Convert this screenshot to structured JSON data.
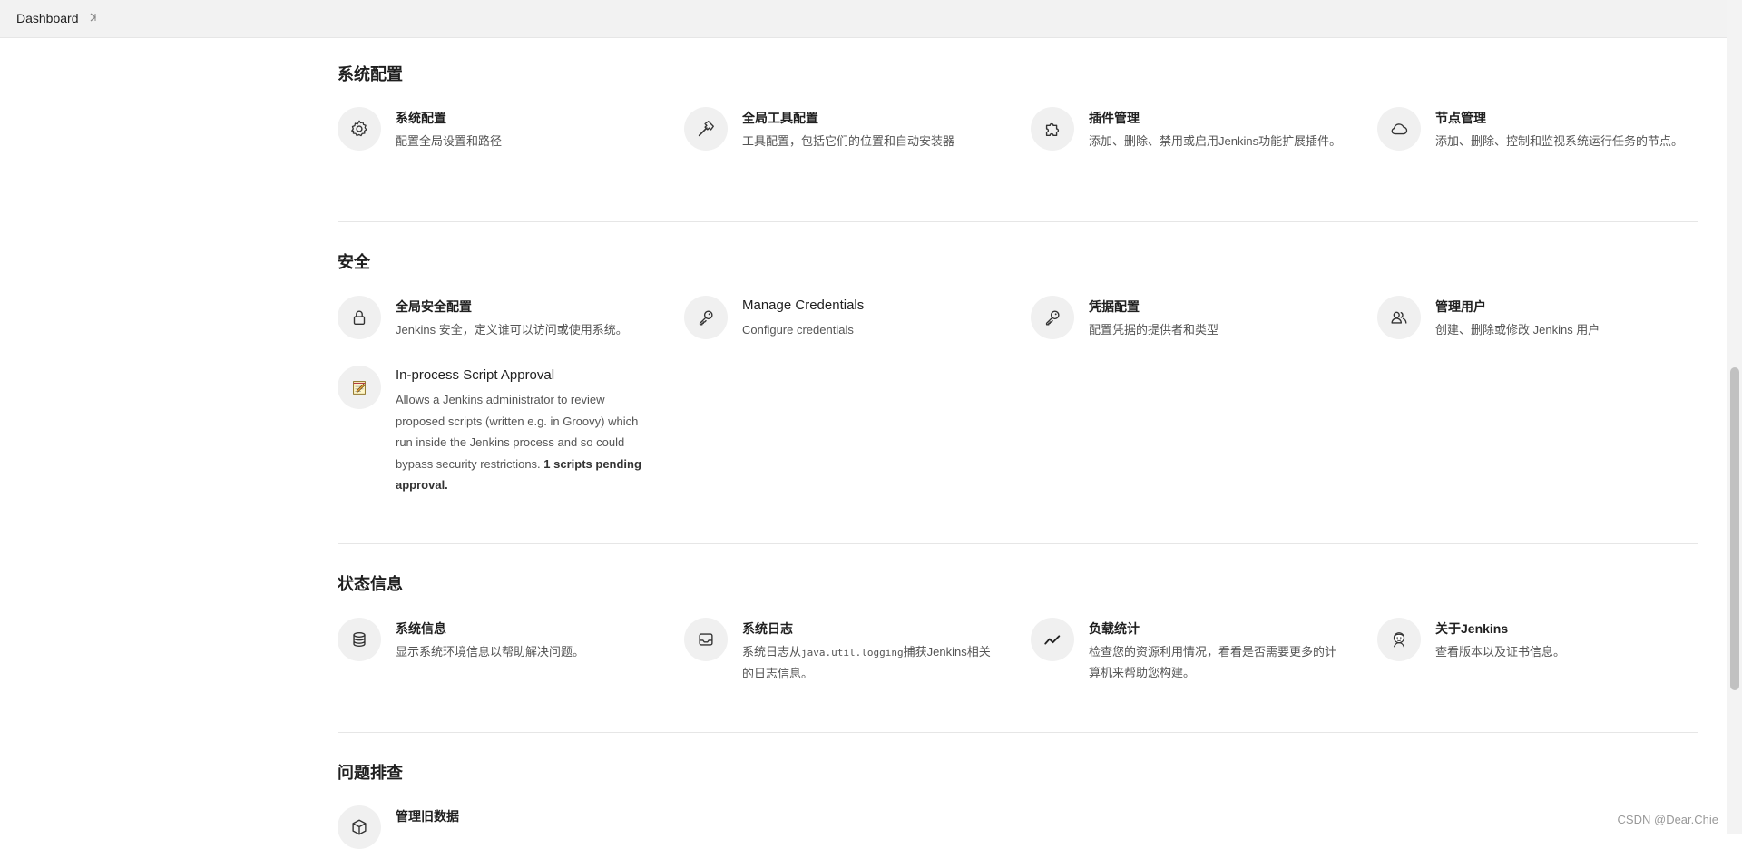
{
  "breadcrumb": {
    "label": "Dashboard"
  },
  "sections": {
    "system": {
      "title": "系统配置",
      "items": [
        {
          "title": "系统配置",
          "desc": "配置全局设置和路径",
          "icon": "gear-icon"
        },
        {
          "title": "全局工具配置",
          "desc": "工具配置，包括它们的位置和自动安装器",
          "icon": "hammer-icon"
        },
        {
          "title": "插件管理",
          "desc": "添加、删除、禁用或启用Jenkins功能扩展插件。",
          "icon": "puzzle-icon"
        },
        {
          "title": "节点管理",
          "desc": "添加、删除、控制和监视系统运行任务的节点。",
          "icon": "cloud-icon"
        }
      ]
    },
    "security": {
      "title": "安全",
      "items": [
        {
          "title": "全局安全配置",
          "desc": "Jenkins 安全，定义谁可以访问或使用系统。",
          "icon": "lock-icon"
        },
        {
          "title": "Manage Credentials",
          "desc": "Configure credentials",
          "icon": "key-icon"
        },
        {
          "title": "凭据配置",
          "desc": "配置凭据的提供者和类型",
          "icon": "key-icon"
        },
        {
          "title": "管理用户",
          "desc": "创建、删除或修改 Jenkins 用户",
          "icon": "users-icon"
        },
        {
          "title": "In-process Script Approval",
          "desc": "Allows a Jenkins administrator to review proposed scripts (written e.g. in Groovy) which run inside the Jenkins process and so could bypass security restrictions.",
          "desc_bold": "1 scripts pending approval.",
          "icon": "notepad-icon"
        }
      ]
    },
    "status": {
      "title": "状态信息",
      "items": [
        {
          "title": "系统信息",
          "desc": "显示系统环境信息以帮助解决问题。",
          "icon": "database-icon"
        },
        {
          "title": "系统日志",
          "desc_pre": "系统日志从",
          "desc_code": "java.util.logging",
          "desc_post": "捕获Jenkins相关的日志信息。",
          "icon": "inbox-icon"
        },
        {
          "title": "负载统计",
          "desc": "检查您的资源利用情况，看看是否需要更多的计算机来帮助您构建。",
          "icon": "trend-icon"
        },
        {
          "title": "关于Jenkins",
          "desc": "查看版本以及证书信息。",
          "icon": "jenkins-logo-icon"
        }
      ]
    },
    "troubleshoot": {
      "title": "问题排查",
      "items": [
        {
          "title": "管理旧数据",
          "icon": "box-icon"
        }
      ]
    }
  },
  "watermark": "CSDN @Dear.Chie"
}
